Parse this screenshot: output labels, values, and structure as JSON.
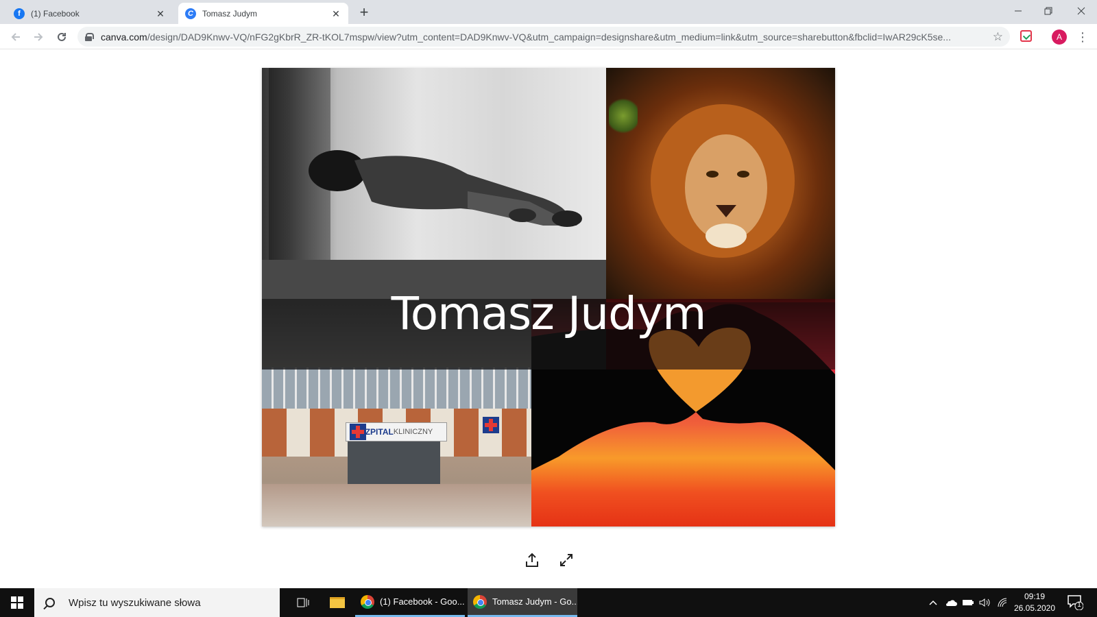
{
  "browser": {
    "tabs": [
      {
        "title": "(1) Facebook",
        "favicon": "facebook-icon",
        "active": false
      },
      {
        "title": "Tomasz Judym",
        "favicon": "canva-icon",
        "active": true
      }
    ],
    "new_tab_label": "+",
    "address": {
      "host": "canva.com",
      "path": "/design/DAD9Knwv-VQ/nFG2gKbrR_ZR-tKOL7mspw/view?utm_content=DAD9Knwv-VQ&utm_campaign=designshare&utm_medium=link&utm_source=sharebutton&fbclid=IwAR29cK5se..."
    },
    "profile_initial": "A",
    "accent_color": "#d81b60"
  },
  "design": {
    "title": "Tomasz Judym",
    "hospital_sign": {
      "bold": "SZPITAL",
      "thin": "KLINICZNY"
    },
    "panels": [
      "homeless-person-photo",
      "lion-photo",
      "hospital-photo",
      "heart-hands-photo"
    ]
  },
  "viewer": {
    "share_icon": "share-icon",
    "fullscreen_icon": "fullscreen-icon"
  },
  "taskbar": {
    "search_placeholder": "Wpisz tu wyszukiwane słowa",
    "apps": [
      {
        "label": "(1) Facebook - Goo...",
        "icon": "chrome-icon",
        "active": false
      },
      {
        "label": "Tomasz Judym - Go...",
        "icon": "chrome-icon",
        "active": true
      }
    ],
    "clock": {
      "time": "09:19",
      "date": "26.05.2020"
    },
    "notification_count": "1"
  }
}
